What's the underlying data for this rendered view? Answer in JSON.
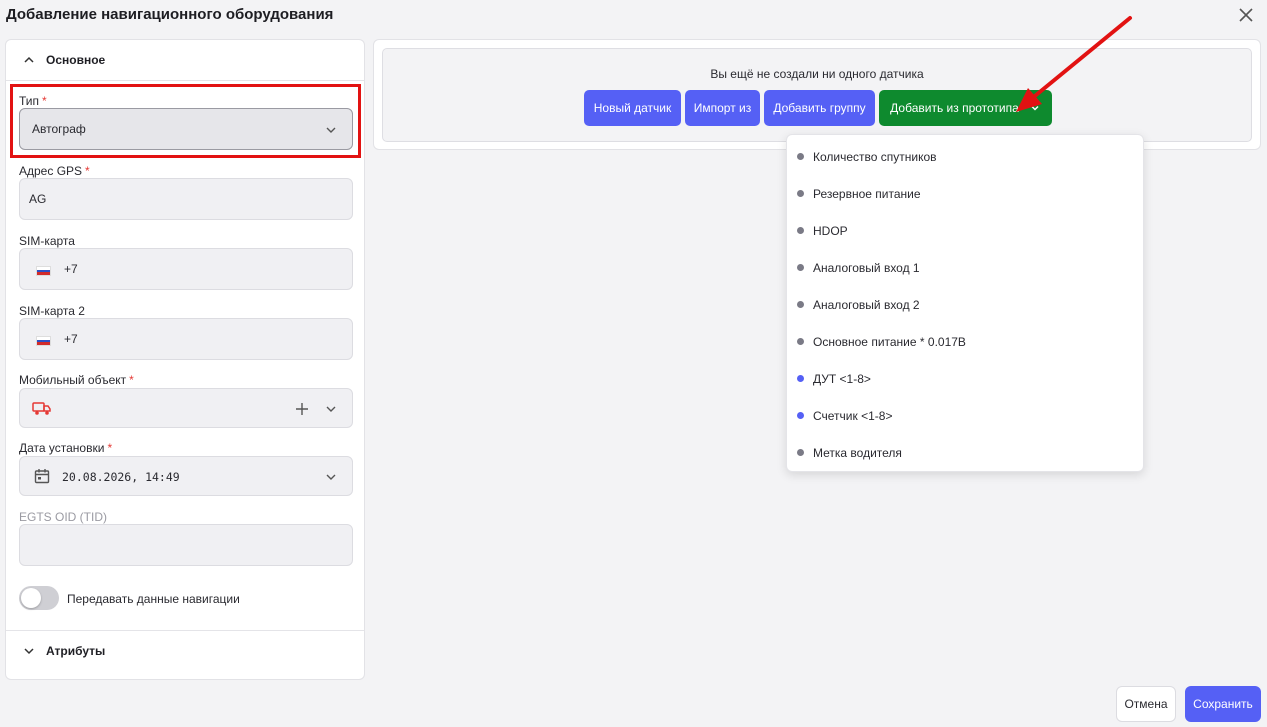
{
  "dialog": {
    "title": "Добавление навигационного оборудования",
    "close_icon": "close-icon"
  },
  "left": {
    "main_section": "Основное",
    "type": {
      "label": "Тип",
      "required_mark": "*",
      "value": "Автограф"
    },
    "gps": {
      "label": "Адрес GPS",
      "required_mark": "*",
      "value": "AG"
    },
    "sim1": {
      "label": "SIM-карта",
      "value": "+7",
      "flag": "ru-flag-icon"
    },
    "sim2": {
      "label": "SIM-карта 2",
      "value": "+7",
      "flag": "ru-flag-icon"
    },
    "mobile": {
      "label": "Мобильный объект",
      "required_mark": "*",
      "icon": "vehicle-icon"
    },
    "install_date": {
      "label": "Дата установки",
      "required_mark": "*",
      "value": "20.08.2026, 14:49"
    },
    "egts": {
      "label": "EGTS OID (TID)",
      "value": ""
    },
    "nav_toggle": {
      "label": "Передавать данные навигации",
      "on": false
    },
    "attributes_section": "Атрибуты"
  },
  "right": {
    "empty_text": "Вы ещё не создали ни одного датчика",
    "buttons": {
      "new_sensor": "Новый датчик",
      "import": "Импорт из",
      "add_group": "Добавить группу",
      "add_from_prototype": "Добавить из прототипа"
    }
  },
  "dropdown": {
    "items": [
      {
        "label": "Количество спутников",
        "color": "#7a7a86"
      },
      {
        "label": "Резервное питание",
        "color": "#7a7a86"
      },
      {
        "label": "HDOP",
        "color": "#7a7a86"
      },
      {
        "label": "Аналоговый вход 1",
        "color": "#7a7a86"
      },
      {
        "label": "Аналоговый вход 2",
        "color": "#7a7a86"
      },
      {
        "label": "Основное питание * 0.017В",
        "color": "#7a7a86"
      },
      {
        "label": "ДУТ <1-8>",
        "color": "#5560f5"
      },
      {
        "label": "Счетчик <1-8>",
        "color": "#5560f5"
      },
      {
        "label": "Метка водителя",
        "color": "#7a7a86"
      }
    ]
  },
  "footer": {
    "cancel": "Отмена",
    "save": "Сохранить"
  },
  "colors": {
    "accent": "#5560f5",
    "green": "#0e8a2e",
    "highlight": "#e21212"
  }
}
